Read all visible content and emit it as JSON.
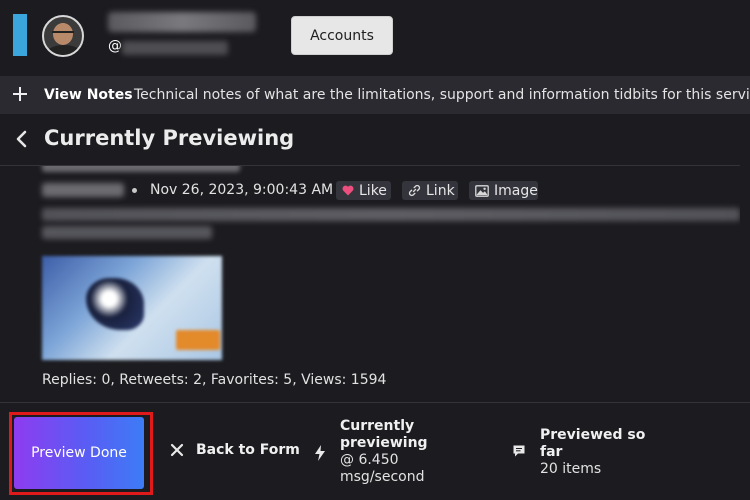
{
  "header": {
    "handle_prefix": "@",
    "accounts_label": "Accounts",
    "accent_color": "#3aa6dc"
  },
  "notes": {
    "label": "View Notes",
    "description": "Technical notes of what are the limitations, support and information tidbits for this service."
  },
  "page": {
    "title": "Currently Previewing"
  },
  "post": {
    "timestamp": "Nov 26, 2023, 9:00:43 AM",
    "actions": {
      "like": "Like",
      "link": "Link",
      "image": "Image"
    },
    "stats": "Replies: 0, Retweets: 2, Favorites: 5, Views: 1594"
  },
  "footer": {
    "preview_done_label": "Preview Done",
    "back_label": "Back to Form",
    "speed": {
      "title": "Currently previewing",
      "value": "@ 6.450 msg/second"
    },
    "count": {
      "title": "Previewed so far",
      "value": "20 items"
    },
    "highlight_color": "#e01a1a",
    "button_gradient": [
      "#8e3cf0",
      "#3d7cf6"
    ]
  }
}
